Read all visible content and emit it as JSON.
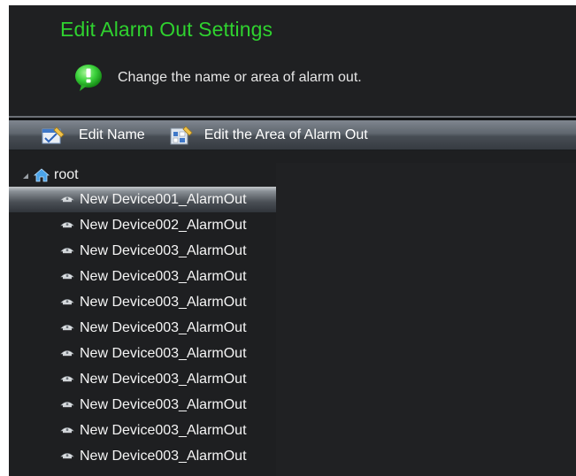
{
  "header": {
    "title": "Edit Alarm Out Settings",
    "hint": "Change the name or area of alarm out."
  },
  "toolbar": {
    "edit_name": "Edit Name",
    "edit_area": "Edit the Area of Alarm Out"
  },
  "tree": {
    "root": "root",
    "items": [
      {
        "label": "New Device001_AlarmOut",
        "selected": true
      },
      {
        "label": "New Device002_AlarmOut"
      },
      {
        "label": "New Device003_AlarmOut"
      },
      {
        "label": "New Device003_AlarmOut"
      },
      {
        "label": "New Device003_AlarmOut"
      },
      {
        "label": "New Device003_AlarmOut"
      },
      {
        "label": "New Device003_AlarmOut"
      },
      {
        "label": "New Device003_AlarmOut"
      },
      {
        "label": "New Device003_AlarmOut"
      },
      {
        "label": "New Device003_AlarmOut"
      },
      {
        "label": "New Device003_AlarmOut"
      }
    ]
  },
  "colors": {
    "title": "#2fd12f",
    "background": "#1e1f21",
    "toolbar": "#5f666e",
    "hint_icon": "#3bd23b"
  },
  "icons": {
    "hint": "info-bubble-icon",
    "edit_name": "edit-name-icon",
    "edit_area": "edit-area-icon",
    "root": "home-icon",
    "item": "alarm-out-icon"
  }
}
